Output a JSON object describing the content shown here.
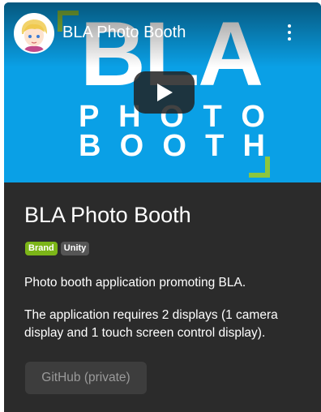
{
  "video": {
    "title": "BLA Photo Booth",
    "thumbnail_text": {
      "big": "BLA",
      "line1": [
        "P",
        "H",
        "O",
        "T",
        "O"
      ],
      "line2": [
        "B",
        "O",
        "O",
        "T",
        "H"
      ]
    },
    "colors": {
      "background": "#0aa0e6",
      "bracket": "#8cc63f"
    },
    "channel_avatar_icon": "avatar-icon",
    "more_icon": "more-vert-icon",
    "play_icon": "play-icon"
  },
  "card": {
    "title": "BLA Photo Booth",
    "badges": [
      {
        "label": "Brand",
        "color": "#7cb518"
      },
      {
        "label": "Unity",
        "color": "#555555"
      }
    ],
    "description": [
      "Photo booth application promoting BLA.",
      "The application requires 2 displays (1 camera display and 1 touch screen control display)."
    ],
    "button_label": "GitHub (private)"
  }
}
